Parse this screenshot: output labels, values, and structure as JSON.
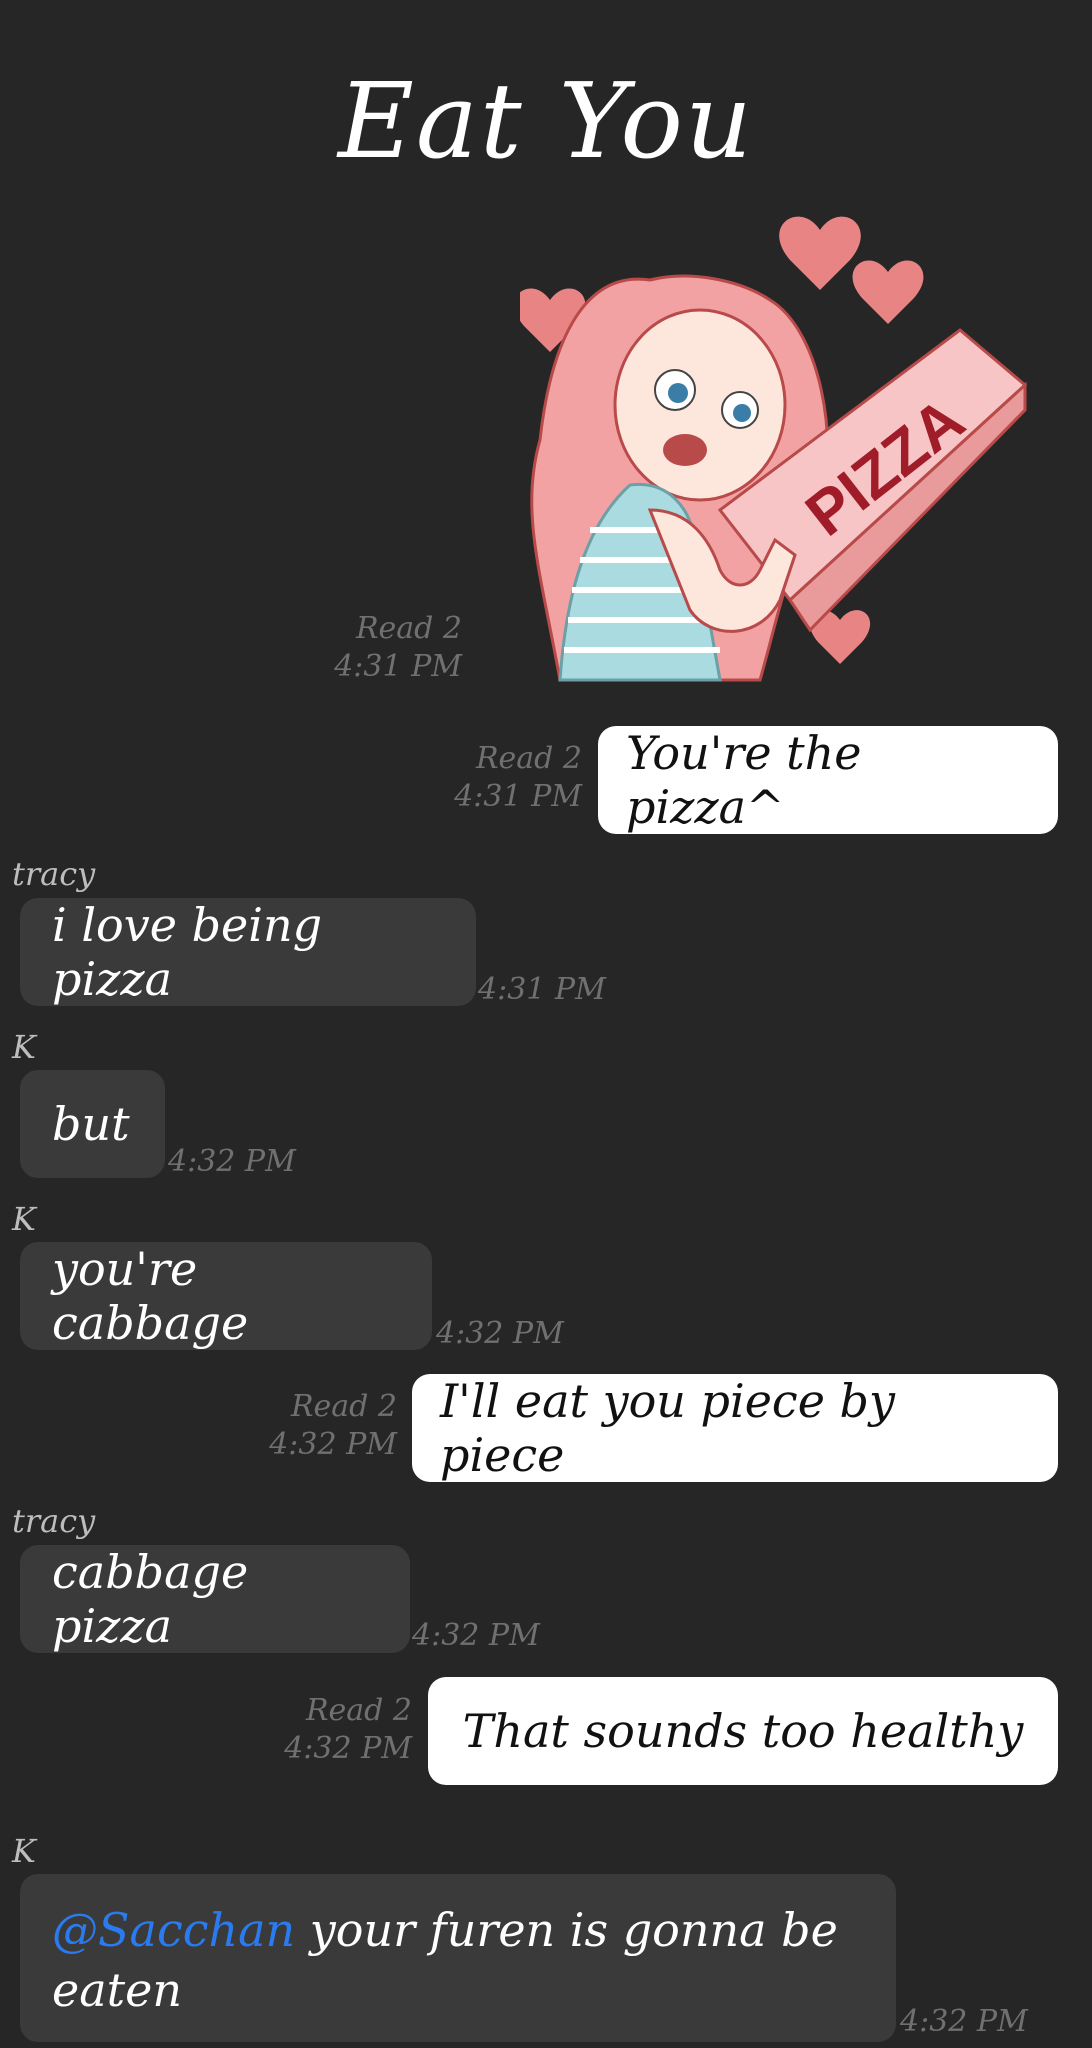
{
  "title": "Eat You",
  "sticker": {
    "text": "PIZZA"
  },
  "messages": [
    {
      "type": "sticker",
      "read": "Read 2",
      "time": "4:31 PM"
    },
    {
      "type": "out",
      "text": "You're the pizza^",
      "read": "Read 2",
      "time": "4:31 PM"
    },
    {
      "type": "in",
      "sender": "tracy",
      "text": "i love being pizza",
      "time": "4:31 PM"
    },
    {
      "type": "in",
      "sender": "K",
      "text": "but",
      "time": "4:32 PM"
    },
    {
      "type": "in",
      "sender": "K",
      "text": "you're cabbage",
      "time": "4:32 PM"
    },
    {
      "type": "out",
      "text": "I'll eat you piece by piece",
      "read": "Read 2",
      "time": "4:32 PM"
    },
    {
      "type": "in",
      "sender": "tracy",
      "text": "cabbage pizza",
      "time": "4:32 PM"
    },
    {
      "type": "out",
      "text": "That sounds too healthy",
      "read": "Read 2",
      "time": "4:32 PM"
    },
    {
      "type": "in",
      "sender": "K",
      "mention": "@Sacchan",
      "text": " your furen is gonna be eaten",
      "time": "4:32 PM"
    }
  ],
  "colors": {
    "background": "#262626",
    "outgoing": "#ffffff",
    "incoming": "#3a3a3a",
    "mention": "#2b7bf0"
  }
}
